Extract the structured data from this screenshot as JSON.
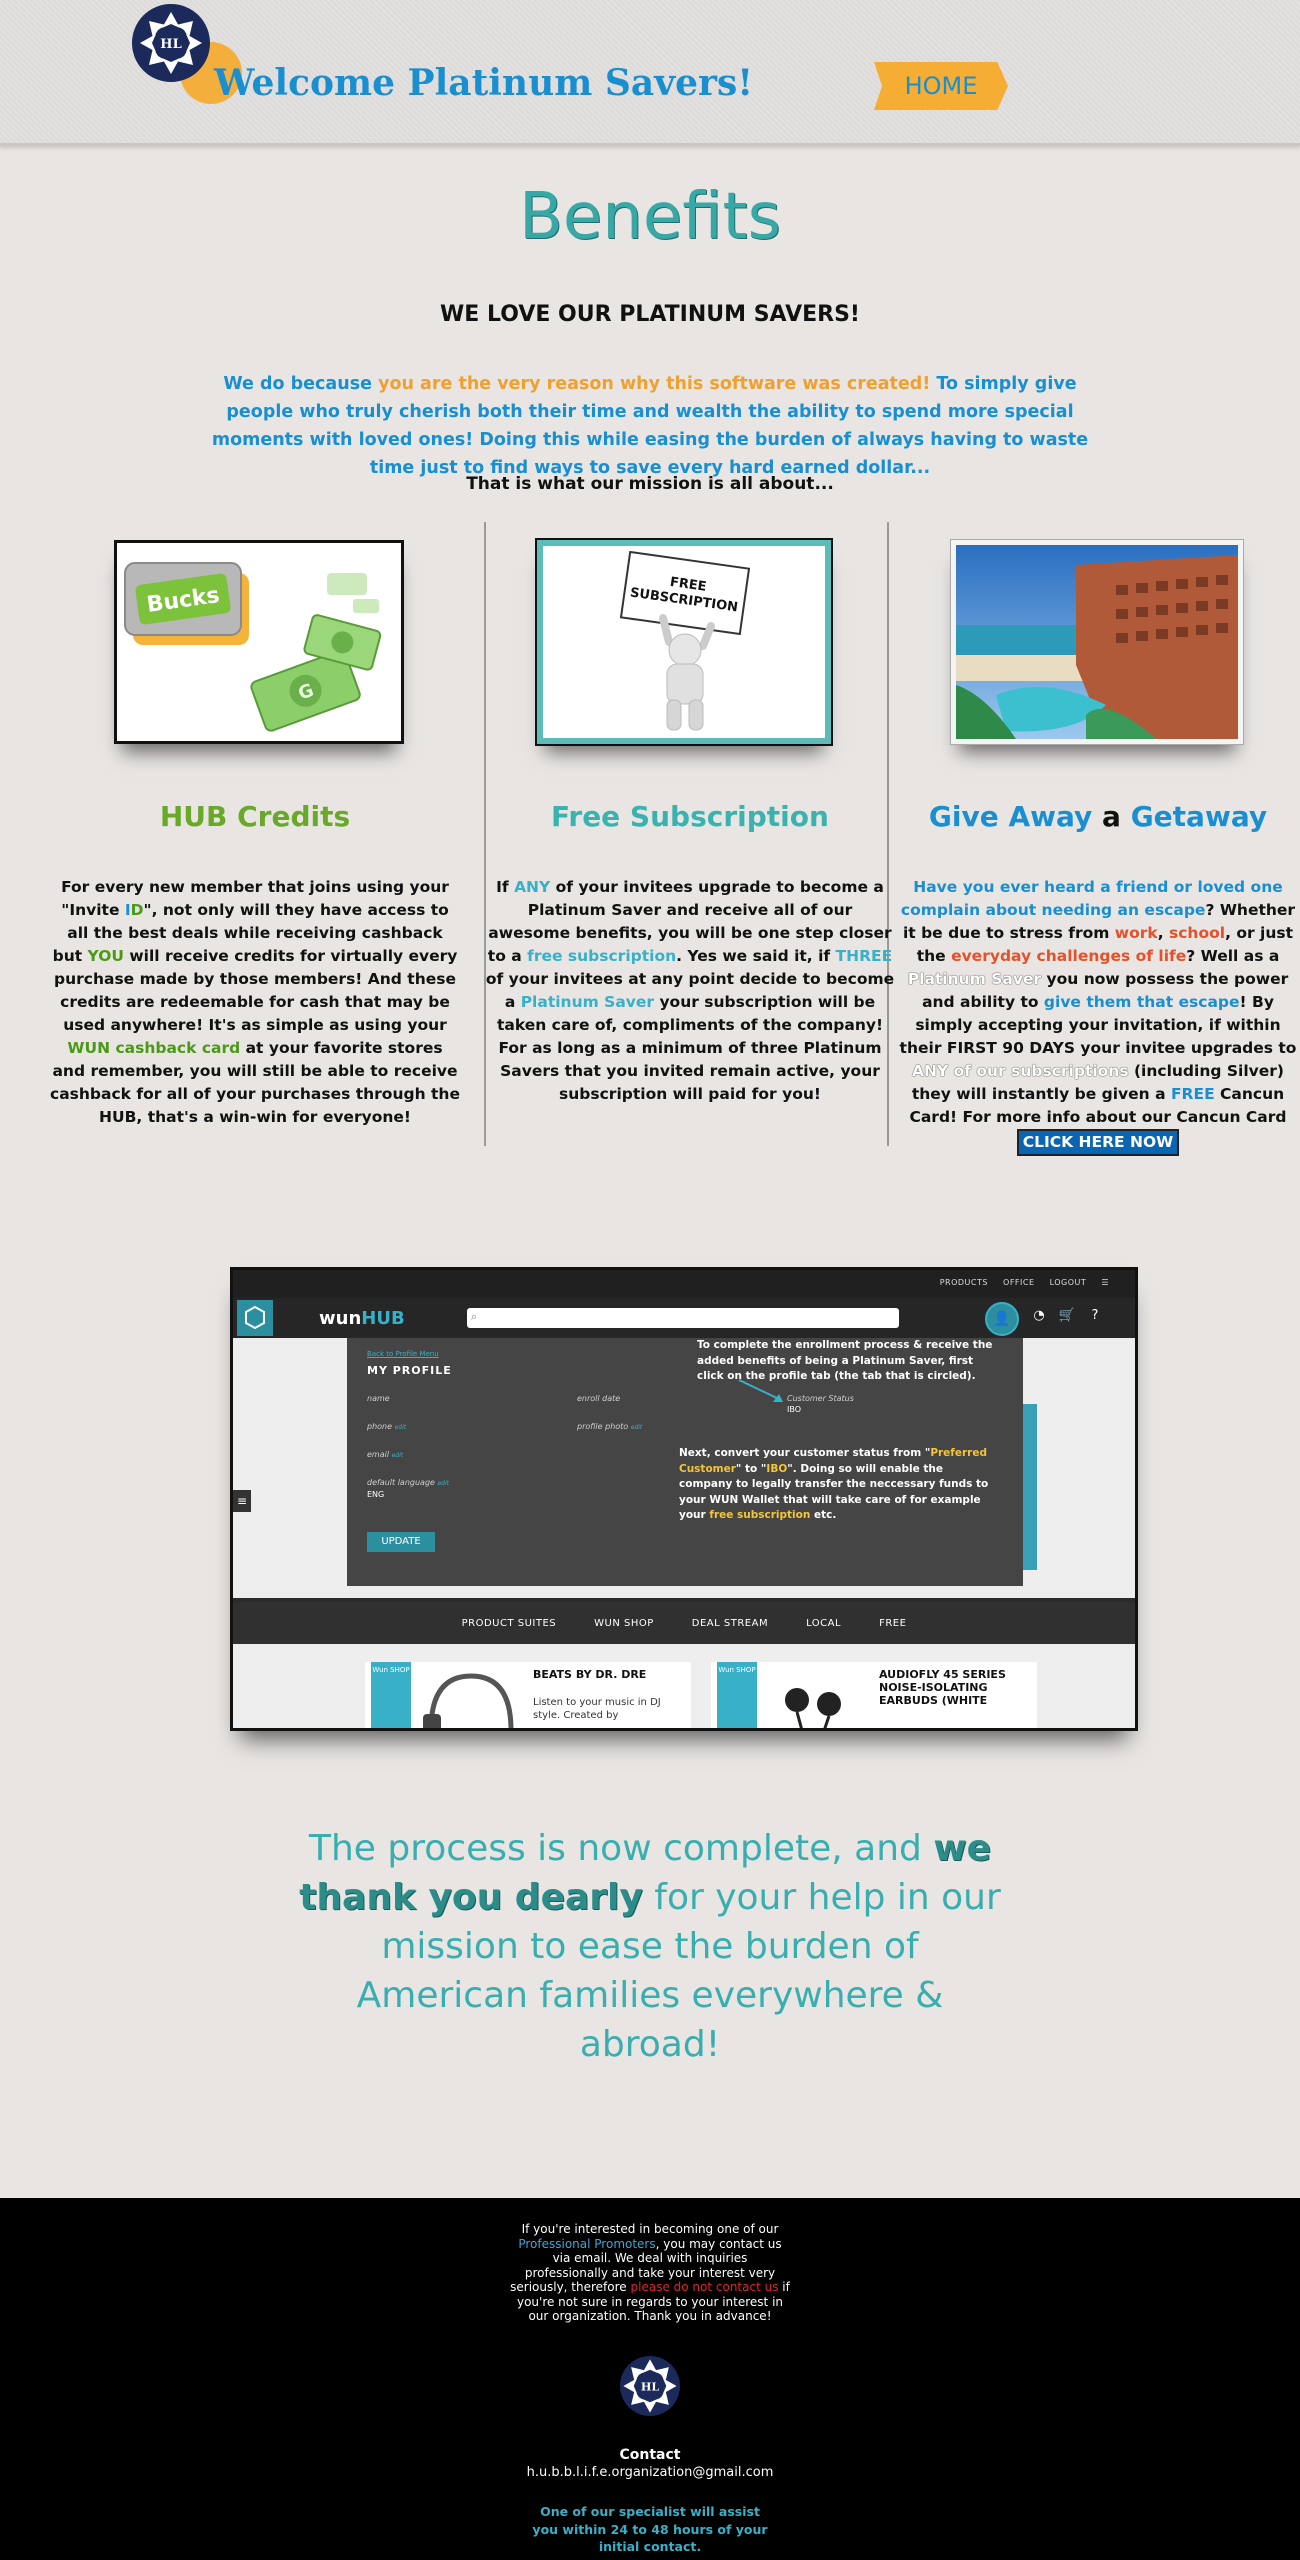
{
  "header": {
    "logo_initials": "HL",
    "site_title": "Welcome Platinum Savers!",
    "home_label": "HOME"
  },
  "intro": {
    "title": "Benefits",
    "heading": "WE LOVE OUR PLATINUM SAVERS!",
    "mission_part1": "We do because ",
    "mission_highlight": "you are the very reason why this software was created!",
    "mission_part2": " To simply give people who truly cherish both their time and wealth the ability to spend more special moments with loved ones! Doing this while easing the burden of always having to waste time just to find ways to save every hard earned dollar...",
    "mission_note": "That is what our mission is all about..."
  },
  "columns": {
    "hub": {
      "title": "HUB Credits",
      "img_badge": "Bucks",
      "body_1": "For every new member that joins using your \"Invite ",
      "body_i": "I",
      "body_d": "D",
      "body_2": "\", not only will they have access to all the best deals while receiving cashback but ",
      "body_you": "YOU",
      "body_3": " will receive credits for virtually every purchase made by those members! And these credits are redeemable for cash that may be used anywhere! It's as simple as using your ",
      "body_card": "WUN cashback card",
      "body_4": " at your favorite stores and remember, you will still be able to receive cashback for all of your purchases through the HUB, that's a win-win for everyone!"
    },
    "subscription": {
      "title": "Free Subscription",
      "img_sign": "FREE SUBSCRIPTION",
      "body_1": "If ",
      "body_any": "ANY",
      "body_2": " of your invitees upgrade to become a Platinum Saver and receive all of our awesome benefits, you will be one step closer to a ",
      "body_free": "free subscription",
      "body_3": ". Yes we said it, if ",
      "body_three": "THREE",
      "body_4": " of your invitees at any point decide to become a ",
      "body_saver": "Platinum Saver",
      "body_5": " your subscription will be taken care of, compliments of the company! For as long as a minimum of three Platinum Savers that you invited remain active, your subscription will paid for you!"
    },
    "getaway": {
      "title_1": "Give Away",
      "title_a": "a",
      "title_2": "Getaway",
      "body_1": "Have you ever heard a friend or loved one complain about needing an escape",
      "body_2": "? Whether it be due to stress from ",
      "body_work": "work",
      "body_comma": ", ",
      "body_school": "school",
      "body_3": ", or just the ",
      "body_everyday": "everyday challenges of life",
      "body_4": "? Well as a ",
      "body_plat": "Platinum Saver",
      "body_5": " you now possess the power and ability to ",
      "body_give": "give them that escape",
      "body_6": "! By simply accepting your invitation, if within their FIRST 90 DAYS your invitee upgrades to ",
      "body_anysub": "ANY of our subscriptions",
      "body_7": " (including Silver) they will instantly be given a ",
      "body_free": "FREE",
      "body_8": " Cancun Card! For more info about our Cancun Card",
      "cta": "CLICK HERE NOW"
    }
  },
  "screenshot": {
    "toplinks": [
      "PRODUCTS",
      "OFFICE",
      "LOGOUT"
    ],
    "brand_wun": "wun",
    "brand_hub": "HUB",
    "back_link": "Back to Profile Menu",
    "profile_title": "MY PROFILE",
    "fields": {
      "name": "name",
      "phone": "phone",
      "email": "email",
      "language": "default language",
      "language_value": "ENG",
      "enroll": "enroll date",
      "photo": "profile photo",
      "status": "Customer Status",
      "status_value": "IBO",
      "edit": "edit"
    },
    "update_label": "UPDATE",
    "note1": "To complete the enrollment process & receive the added benefits of being a Platinum Saver, first click on the profile tab (the tab that is circled).",
    "note2_1": "Next, convert your customer status from \"",
    "note2_pc": "Preferred Customer",
    "note2_2": "\" to \"",
    "note2_ibo": "IBO",
    "note2_3": "\". Doing so will enable the company to legally transfer the neccessary funds to your WUN Wallet that will take care of for example your ",
    "note2_free": "free subscription",
    "note2_4": " etc.",
    "menu": [
      "PRODUCT SUITES",
      "WUN SHOP",
      "DEAL STREAM",
      "LOCAL",
      "FREE"
    ],
    "products": [
      {
        "tag": "Wun SHOP",
        "title": "BEATS BY DR. DRE",
        "desc": "Listen to your music in DJ style. Created by"
      },
      {
        "tag": "Wun SHOP",
        "title": "AUDIOFLY 45 SERIES NOISE-ISOLATING EARBUDS (WHITE",
        "desc": ""
      }
    ]
  },
  "closing": {
    "line_1": "The process is now complete, and ",
    "strong": "we thank you dearly",
    "line_2": " for your help in our mission to ease the burden of American families everywhere & abroad!"
  },
  "footer": {
    "text_1": "If you're interested in becoming one of our ",
    "promoters": "Professional Promoters",
    "text_2": ", you may contact us via email.  We deal with inquiries professionally and take your interest very seriously, therefore ",
    "do_not": "please do not contact us",
    "text_3": " if you're not sure in regards to your interest in our organization. Thank you in advance!",
    "logo_initials": "HL",
    "contact_label": "Contact",
    "email": "h.u.b.b.l.i.f.e.organization@gmail.com",
    "assist": "One of our specialist will assist you within 24 to 48 hours of your initial contact."
  }
}
